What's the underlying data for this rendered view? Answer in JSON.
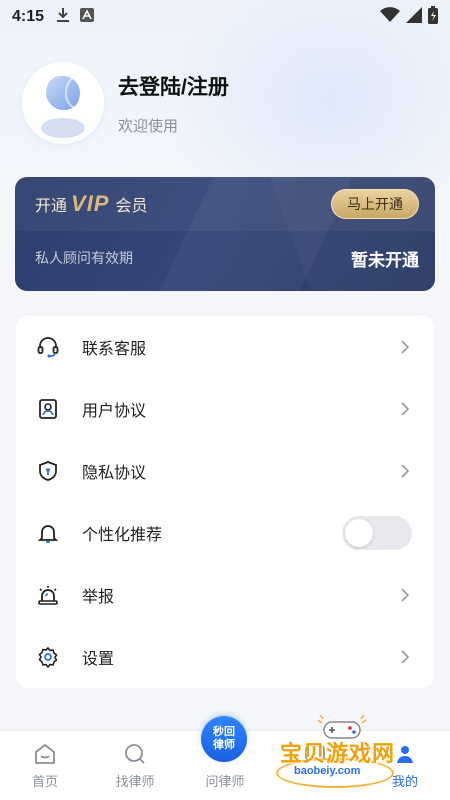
{
  "status_bar": {
    "time": "4:15"
  },
  "profile": {
    "title": "去登陆/注册",
    "subtitle": "欢迎使用"
  },
  "vip": {
    "open_text": "开通",
    "logo": "VIP",
    "member_text": "会员",
    "button_label": "马上开通",
    "validity_label": "私人顾问有效期",
    "status": "暂未开通"
  },
  "menu": {
    "items": [
      {
        "label": "联系客服",
        "icon": "headset-icon"
      },
      {
        "label": "用户协议",
        "icon": "user-doc-icon"
      },
      {
        "label": "隐私协议",
        "icon": "shield-icon"
      },
      {
        "label": "个性化推荐",
        "icon": "bell-icon"
      },
      {
        "label": "举报",
        "icon": "alarm-icon"
      },
      {
        "label": "设置",
        "icon": "gear-icon"
      }
    ],
    "personalization_enabled": false
  },
  "nav": {
    "home": "首页",
    "find_lawyer": "找律师",
    "ask_lawyer": "问律师",
    "badge_line1": "秒回",
    "badge_line2": "律师",
    "mine": "我的"
  },
  "watermark": {
    "text": "宝贝游戏网",
    "url": "baobeiy.com"
  },
  "colors": {
    "accent": "#2a6df5",
    "vip_bg": "#2d3e6c",
    "vip_gold": "#d8b97b"
  }
}
